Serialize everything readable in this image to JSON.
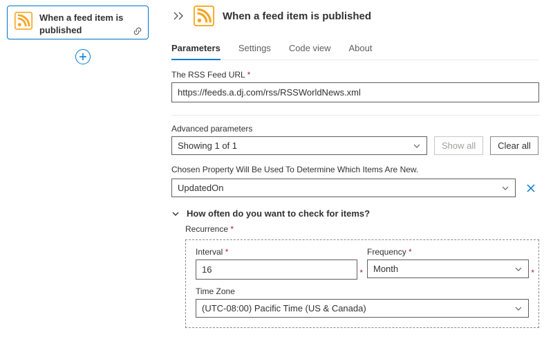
{
  "card": {
    "title": "When a feed item is published"
  },
  "panel": {
    "title": "When a feed item is published"
  },
  "tabs": {
    "parameters": "Parameters",
    "settings": "Settings",
    "codeview": "Code view",
    "about": "About"
  },
  "feed": {
    "label": "The RSS Feed URL",
    "value": "https://feeds.a.dj.com/rss/RSSWorldNews.xml"
  },
  "advanced": {
    "label": "Advanced parameters",
    "selectText": "Showing 1 of 1",
    "showAll": "Show all",
    "clearAll": "Clear all"
  },
  "chosen": {
    "label": "Chosen Property Will Be Used To Determine Which Items Are New.",
    "value": "UpdatedOn"
  },
  "accordion": {
    "title": "How often do you want to check for items?"
  },
  "recurrence": {
    "label": "Recurrence",
    "intervalLabel": "Interval",
    "intervalValue": "16",
    "frequencyLabel": "Frequency",
    "frequencyValue": "Month",
    "tzLabel": "Time Zone",
    "tzValue": "(UTC-08:00) Pacific Time (US & Canada)"
  }
}
